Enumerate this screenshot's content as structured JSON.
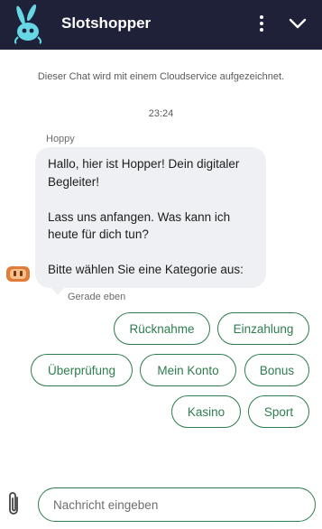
{
  "header": {
    "title": "Slotshopper",
    "logo_icon": "rabbit-logo-icon",
    "menu_icon": "kebab-menu-icon",
    "collapse_icon": "chevron-down-icon",
    "background": "#1f2139",
    "logo_color": "#67d7e6"
  },
  "chat": {
    "notice": "Dieser Chat wird mit einem Cloudservice aufgezeichnet.",
    "timestamp": "23:24",
    "sender": "Hoppy",
    "message_lines": [
      "Hallo, hier ist Hopper! Dein digitaler Begleiter!",
      "Lass uns anfangen. Was kann ich heute für dich tun?",
      "Bitte wählen Sie eine Kategorie aus:"
    ],
    "message_status": "Gerade eben",
    "avatar_icon": "bot-avatar-icon"
  },
  "quick_replies": [
    "Rücknahme",
    "Einzahlung",
    "Überprüfung",
    "Mein Konto",
    "Bonus",
    "Kasino",
    "Sport"
  ],
  "composer": {
    "attach_icon": "paperclip-icon",
    "placeholder": "Nachricht eingeben",
    "value": ""
  },
  "colors": {
    "accent": "#2e7d4e",
    "bubble": "#eef0f3"
  }
}
